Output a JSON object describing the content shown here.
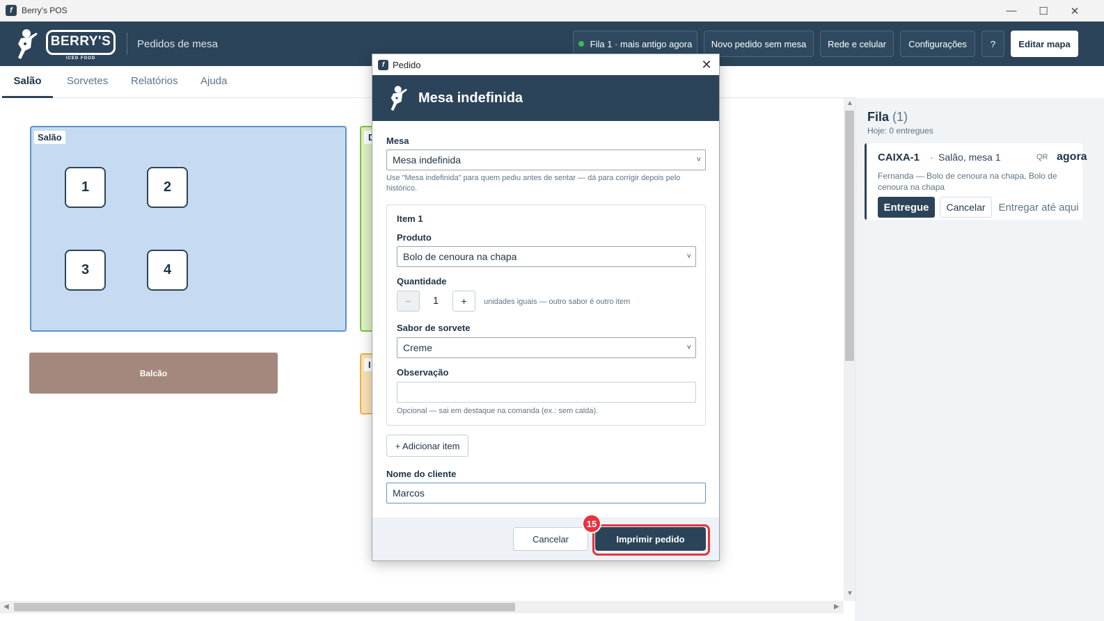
{
  "window": {
    "title": "Berry's POS",
    "min_glyph": "—",
    "max_glyph": "☐",
    "close_glyph": "✕"
  },
  "header": {
    "logo_text": "BERRY'S",
    "logo_sub": "ICED FOOD",
    "page_title": "Pedidos de mesa",
    "queue_button": "Fila 1 · mais antigo agora",
    "new_order_button": "Novo pedido sem mesa",
    "network_button": "Rede e celular",
    "settings_button": "Configurações",
    "help_button": "?",
    "edit_map_button": "Editar mapa",
    "queue_status_color": "#3dbd5b",
    "brand_color": "#2b4459"
  },
  "tabs": [
    "Salão",
    "Sorvetes",
    "Relatórios",
    "Ajuda"
  ],
  "floor": {
    "salao_label": "Salão",
    "tables": [
      "1",
      "2",
      "3",
      "4"
    ],
    "green_area_label": "D",
    "orange_area_label": "I",
    "counter_label": "Balcão",
    "colors": {
      "salao_fill": "#c6dbf1",
      "salao_border": "#5b93d3",
      "green_fill": "#dff2c5",
      "orange_fill": "#fbe3b8",
      "counter_fill": "#a5887d"
    }
  },
  "queue_panel": {
    "title": "Fila",
    "count": "(1)",
    "subtitle": "Hoje: 0 entregues",
    "order": {
      "code": "CAIXA-1",
      "separator": "·",
      "location": "Salão, mesa 1",
      "source": "QR",
      "time": "agora",
      "description": "Fernanda — Bolo de cenoura na chapa, Bolo de cenoura na chapa",
      "deliver_button": "Entregue",
      "cancel_button": "Cancelar",
      "deliver_here_button": "Entregar até aqui"
    }
  },
  "modal": {
    "window_title": "Pedido",
    "close_glyph": "✕",
    "heading": "Mesa indefinida",
    "mesa_label": "Mesa",
    "mesa_value": "Mesa indefinida",
    "mesa_hint": "Use \"Mesa indefinida\" para quem pediu antes de sentar — dá para corrigir depois pelo histórico.",
    "item": {
      "title": "Item 1",
      "product_label": "Produto",
      "product_value": "Bolo de cenoura na chapa",
      "quantity_label": "Quantidade",
      "quantity_minus": "−",
      "quantity_value": "1",
      "quantity_plus": "+",
      "quantity_hint": "unidades iguais — outro sabor é outro item",
      "flavor_label": "Sabor de sorvete",
      "flavor_value": "Creme",
      "note_label": "Observação",
      "note_value": "",
      "note_hint": "Opcional — sai em destaque na comanda (ex.: sem calda)."
    },
    "add_item_button": "+ Adicionar item",
    "client_label": "Nome do cliente",
    "client_value": "Marcos",
    "cancel_button": "Cancelar",
    "print_button": "Imprimir pedido"
  },
  "step_badge": "15",
  "chevron_glyph": "˅"
}
